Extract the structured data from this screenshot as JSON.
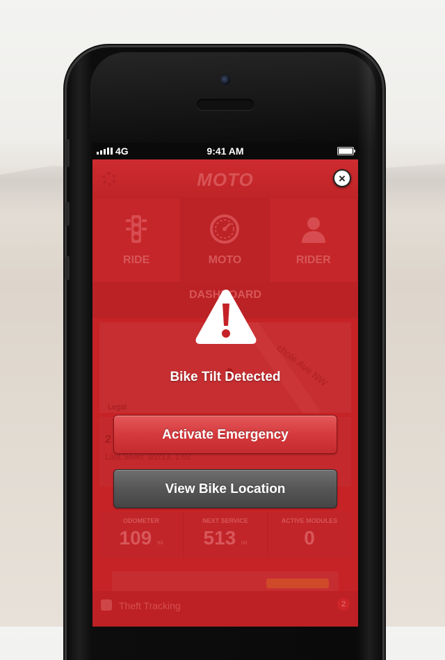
{
  "status_bar": {
    "network": "4G",
    "time": "9:41 AM"
  },
  "app": {
    "title": "MOTO",
    "tabs": [
      {
        "label": "RIDE",
        "icon": "traffic-light-icon"
      },
      {
        "label": "MOTO",
        "icon": "speedometer-icon"
      },
      {
        "label": "RIDER",
        "icon": "person-icon"
      }
    ],
    "section_title": "DASHBOARD",
    "map": {
      "street_label": "chole Ave NW",
      "legal_label": "Legal"
    },
    "card": {
      "number_fragment": "2",
      "last_seen": "Last Seen: 3/2/13, 1:02"
    },
    "stats": [
      {
        "label": "ODOMETER",
        "value": "109",
        "unit": "mi"
      },
      {
        "label": "NEXT SERVICE",
        "value": "513",
        "unit": "mi"
      },
      {
        "label": "ACTIVE MODULES",
        "value": "0",
        "unit": ""
      }
    ],
    "bottom_bar": {
      "label": "Theft Tracking",
      "badge": "2"
    }
  },
  "alert": {
    "icon": "warning-icon",
    "title": "Bike Tilt Detected",
    "primary_button": "Activate Emergency",
    "secondary_button": "View Bike Location"
  },
  "colors": {
    "app_red": "#c5272a",
    "emergency_button": "#d53a3d",
    "location_button": "#565656"
  }
}
